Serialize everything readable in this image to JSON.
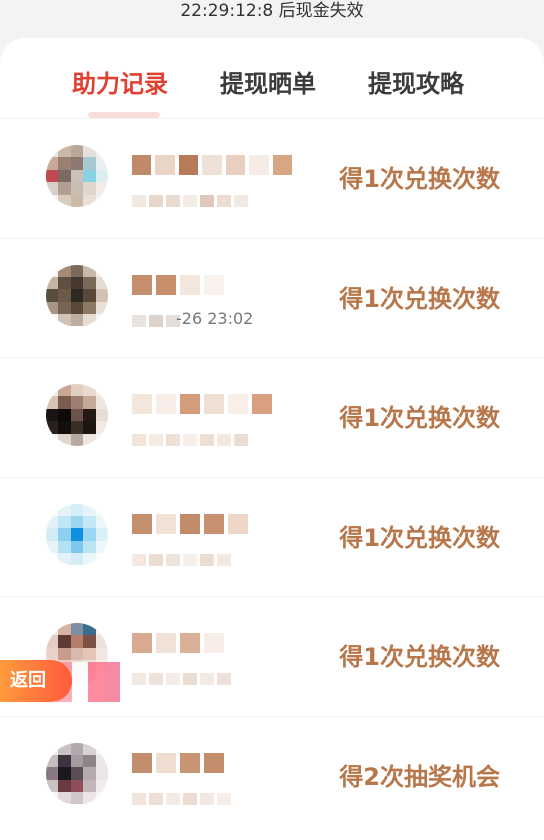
{
  "banner": {
    "countdown_text": "22:29:12:8 后现金失效"
  },
  "tabs": [
    {
      "label": "助力记录",
      "active": true
    },
    {
      "label": "提现晒单",
      "active": false
    },
    {
      "label": "提现攻略",
      "active": false
    }
  ],
  "records": [
    {
      "reward": "得1次兑换次数",
      "time_fragment": ""
    },
    {
      "reward": "得1次兑换次数",
      "time_fragment": "-26 23:02"
    },
    {
      "reward": "得1次兑换次数",
      "time_fragment": ""
    },
    {
      "reward": "得1次兑换次数",
      "time_fragment": ""
    },
    {
      "reward": "得1次兑换次数",
      "time_fragment": ""
    },
    {
      "reward": "得2次抽奖机会",
      "time_fragment": ""
    }
  ],
  "return_button": {
    "label": "返回"
  },
  "colors": {
    "active_tab": "#e0402f",
    "reward_text": "#b8774a",
    "return_button": "#ff7a3c"
  }
}
